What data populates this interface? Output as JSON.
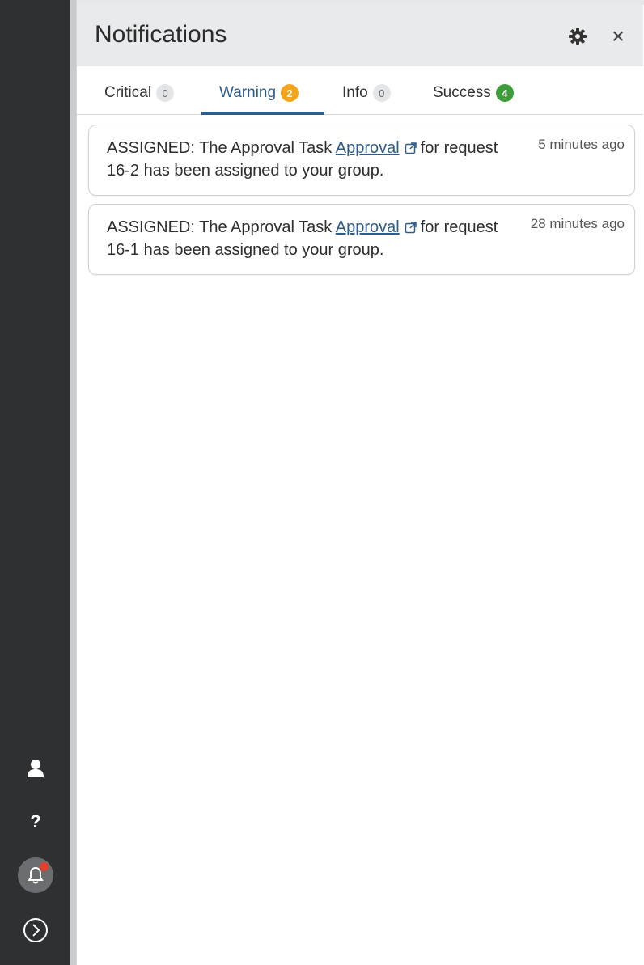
{
  "header": {
    "title": "Notifications",
    "settings_icon": "gear-icon",
    "close_label": "×"
  },
  "tabs": [
    {
      "label": "Critical",
      "count": "0",
      "active": false
    },
    {
      "label": "Warning",
      "count": "2",
      "active": true
    },
    {
      "label": "Info",
      "count": "0",
      "active": false
    },
    {
      "label": "Success",
      "count": "4",
      "active": false
    }
  ],
  "notifications": [
    {
      "prefix": "ASSIGNED: The Approval Task ",
      "link": "Approval",
      "suffix": "for request 16-2 has been assigned to your group.",
      "time": "5 minutes ago"
    },
    {
      "prefix": "ASSIGNED: The Approval Task ",
      "link": "Approval",
      "suffix": "for request 16-1 has been assigned to your group.",
      "time": "28 minutes ago"
    }
  ],
  "sidebar": {
    "items": [
      {
        "icon": "user-icon"
      },
      {
        "icon": "help-icon",
        "label": "?"
      },
      {
        "icon": "bell-icon",
        "has_alert": true
      },
      {
        "icon": "expand-icon"
      }
    ]
  },
  "colors": {
    "accent": "#2f5d8a",
    "warning_badge": "#f4a51c",
    "success_badge": "#3e9c3a",
    "alert_dot": "#e2402c",
    "rail": "#2f3032"
  }
}
